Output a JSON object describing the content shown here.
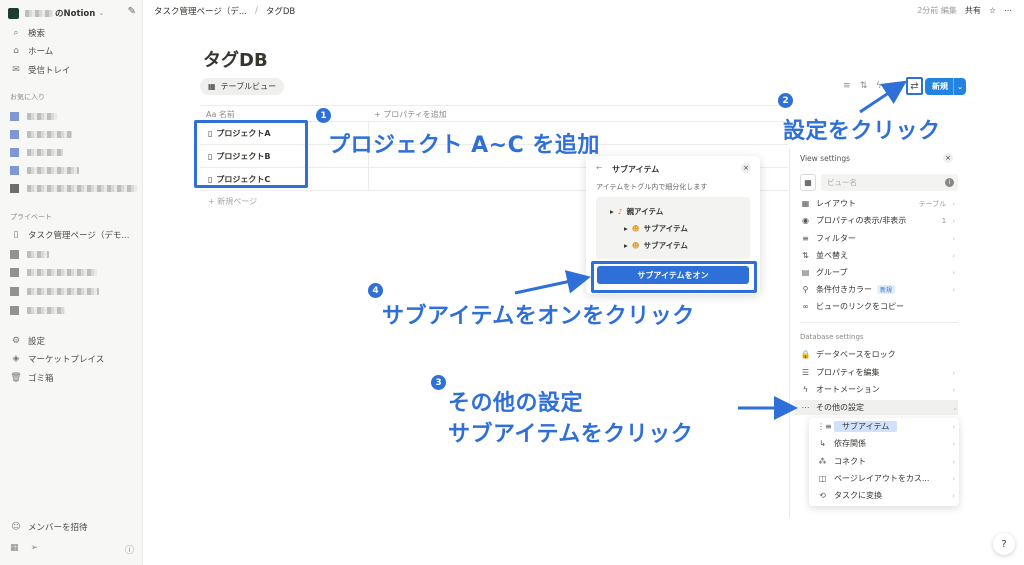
{
  "sidebar": {
    "workspace": "のNotion",
    "items": [
      {
        "label": "検索",
        "icon": "search-icon"
      },
      {
        "label": "ホーム",
        "icon": "home-icon"
      },
      {
        "label": "受信トレイ",
        "icon": "inbox-icon"
      }
    ],
    "favorites_label": "お気に入り",
    "private_label": "プライベート",
    "private_page": "タスク管理ページ（デモ...",
    "settings": "設定",
    "marketplace": "マーケットプレイス",
    "trash": "ゴミ箱",
    "invite": "メンバーを招待"
  },
  "topbar": {
    "crumb1": "タスク管理ページ（デ...",
    "crumb_sep": "/",
    "crumb2": "タグDB",
    "edited": "2分前 編集",
    "share": "共有"
  },
  "page": {
    "title": "タグDB",
    "view_tab": "テーブルビュー",
    "new_button": "新規",
    "col_name": "名前",
    "add_property": "+ プロパティを追加",
    "rows": [
      "プロジェクトA",
      "プロジェクトB",
      "プロジェクトC"
    ],
    "new_page": "+ 新規ページ"
  },
  "popup": {
    "title": "サブアイテム",
    "description": "アイテムをトグル内で細分化します",
    "parent": "親アイテム",
    "child1": "サブアイテム",
    "child2": "サブアイテム",
    "button": "サブアイテムをオン"
  },
  "panel": {
    "title": "View settings",
    "view_name_placeholder": "ビュー名",
    "view_rows": [
      {
        "label": "レイアウト",
        "value": "テーブル",
        "icon": "layout-icon"
      },
      {
        "label": "プロパティの表示/非表示",
        "value": "1",
        "icon": "eye-icon"
      },
      {
        "label": "フィルター",
        "value": "",
        "icon": "filter-icon"
      },
      {
        "label": "並べ替え",
        "value": "",
        "icon": "sort-icon"
      },
      {
        "label": "グループ",
        "value": "",
        "icon": "group-icon"
      },
      {
        "label": "条件付きカラー",
        "value": "",
        "icon": "paint-icon"
      },
      {
        "label": "ビューのリンクをコピー",
        "value": "",
        "icon": "link-icon"
      }
    ],
    "new_badge": "新規",
    "db_section": "Database settings",
    "db_rows": [
      {
        "label": "データベースをロック",
        "icon": "lock-icon"
      },
      {
        "label": "プロパティを編集",
        "icon": "list-icon"
      },
      {
        "label": "オートメーション",
        "icon": "bolt-icon"
      },
      {
        "label": "その他の設定",
        "icon": "more-icon"
      }
    ],
    "more_rows": [
      {
        "label": "サブアイテム",
        "icon": "subitem-icon"
      },
      {
        "label": "依存関係",
        "icon": "dependency-icon"
      },
      {
        "label": "コネクト",
        "icon": "connect-icon"
      },
      {
        "label": "ページレイアウトをカス...",
        "icon": "page-layout-icon"
      },
      {
        "label": "タスクに変換",
        "icon": "convert-icon"
      }
    ]
  },
  "annotations": {
    "step1": "1",
    "step1_text": "プロジェクト A~C を追加",
    "step2": "2",
    "step2_text": "設定をクリック",
    "step3": "3",
    "step3_text_line1": "その他の設定",
    "step3_text_line2": "サブアイテムをクリック",
    "step4": "4",
    "step4_text": "サブアイテムをオンをクリック"
  },
  "colors": {
    "accent": "#2f6fd8",
    "new_button": "#2383e2",
    "sidebar_bg": "#f7f7f5"
  }
}
